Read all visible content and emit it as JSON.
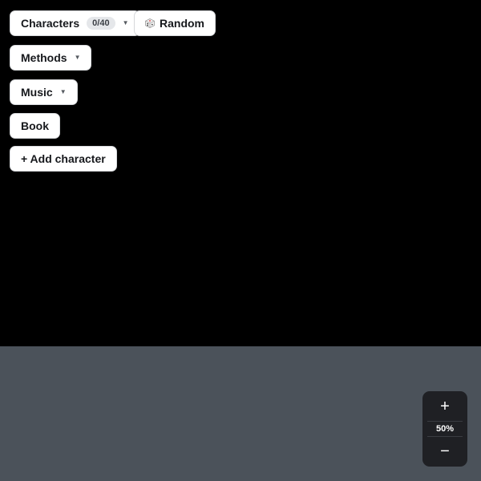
{
  "toolbar": {
    "characters": {
      "label": "Characters",
      "count": "0/40"
    },
    "random": {
      "label": "Random",
      "icon": "dice-icon"
    },
    "methods": {
      "label": "Methods"
    },
    "music": {
      "label": "Music"
    },
    "book": {
      "label": "Book"
    },
    "add_character": {
      "label": "+ Add character"
    }
  },
  "zoom": {
    "plus": "+",
    "level": "50%",
    "minus": "−"
  },
  "colors": {
    "canvas_top": "#000000",
    "canvas_bottom": "#4b525a",
    "zoom_panel": "#1f2024"
  }
}
